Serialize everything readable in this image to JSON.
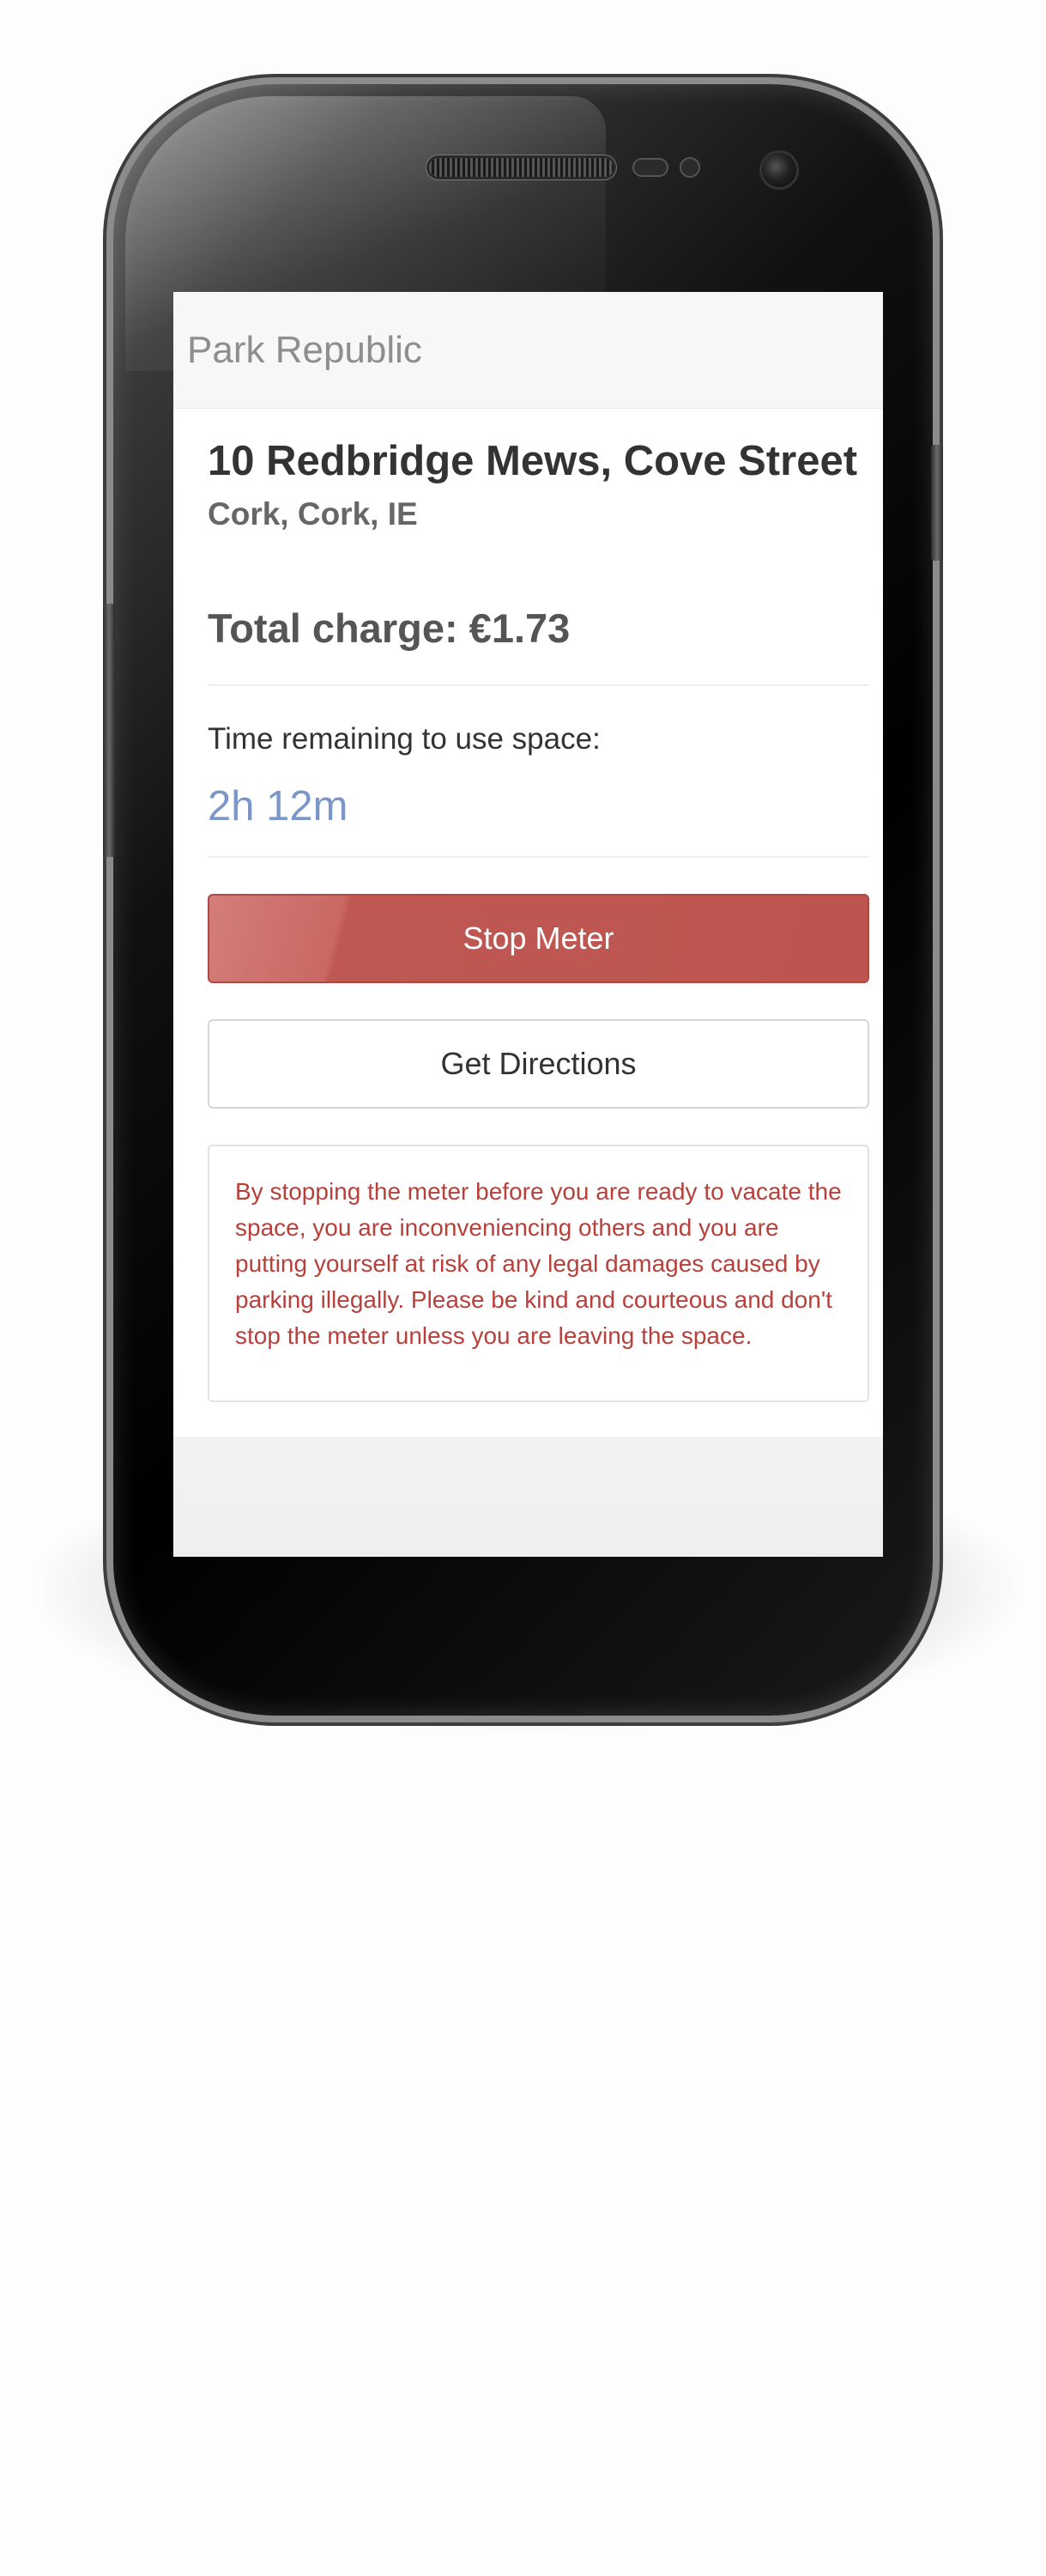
{
  "app": {
    "brand": "Park Republic"
  },
  "location": {
    "address": "10 Redbridge Mews, Cove Street",
    "city": "Cork, Cork, IE"
  },
  "charge": {
    "total_text": "Total charge: €1.73"
  },
  "time": {
    "label": "Time remaining to use space:",
    "value": "2h 12m"
  },
  "actions": {
    "stop_label": "Stop Meter",
    "directions_label": "Get Directions"
  },
  "warning": {
    "text": "By stopping the meter before you are ready to vacate the space, you are inconveniencing others and you are putting yourself at risk of any legal damages caused by parking illegally. Please be kind and courteous and don't stop the meter unless you are leaving the space."
  },
  "colors": {
    "danger": "#bd544f",
    "time_accent": "#7b97c9",
    "warning_text": "#b8403b"
  }
}
